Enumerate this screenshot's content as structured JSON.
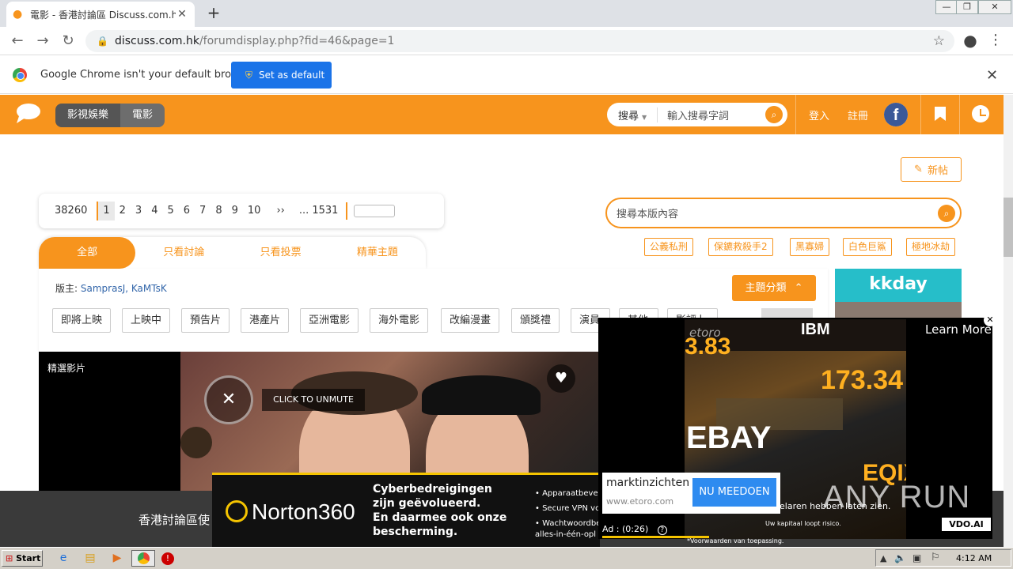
{
  "browser": {
    "tab_title": "電影 - 香港討論區 Discuss.com.hk -",
    "new_tab": "+",
    "url_host": "discuss.com.hk",
    "url_path": "/forumdisplay.php?fid=46&page=1",
    "window_controls": [
      "—",
      "❐",
      "✕"
    ]
  },
  "infobar": {
    "message": "Google Chrome isn't your default browser",
    "button": "Set as default"
  },
  "header": {
    "crumbs": [
      "影視娛樂",
      "電影"
    ],
    "search_type": "搜尋",
    "search_placeholder": "輸入搜尋字詞",
    "login": "登入",
    "register": "註冊",
    "facebook": "f"
  },
  "actions": {
    "new_post": "新帖"
  },
  "pager": {
    "total": "38260",
    "pages": [
      "1",
      "2",
      "3",
      "4",
      "5",
      "6",
      "7",
      "8",
      "9",
      "10"
    ],
    "next": "››",
    "last": "... 1531"
  },
  "board_search": {
    "placeholder": "搜尋本版內容"
  },
  "hot_tags": [
    "公義私刑",
    "保鑣救殺手2",
    "黑寡婦",
    "白色巨鯊",
    "極地冰劫"
  ],
  "filter_tabs": [
    "全部",
    "只看討論",
    "只看投票",
    "精華主題"
  ],
  "moderators": {
    "label": "版主:",
    "names": "SamprasJ, KaMTsK"
  },
  "topic_category": "主題分類",
  "categories": [
    "即將上映",
    "上映中",
    "預告片",
    "港產片",
    "亞洲電影",
    "海外電影",
    "改編漫畫",
    "頒獎禮",
    "演員",
    "其他",
    "影評卜"
  ],
  "featured": {
    "label": "精選影片",
    "unmute": "CLICK TO UNMUTE"
  },
  "kkday": "kkday",
  "footer_band_text": "香港討論區使",
  "norton": {
    "logo": "Norton360",
    "headline": [
      "Cyberbedreigingen",
      "zijn geëvolueerd.",
      "En daarmee ook onze",
      "bescherming."
    ],
    "bullets": [
      "• Apparaatbeveili",
      "• Secure VPN voo",
      "• Wachtwoordbel",
      "  alles-in-één-opl"
    ]
  },
  "etoro": {
    "learn_more": "Learn More",
    "close": "✕",
    "name": "marktinzichten",
    "url": "www.etoro.com",
    "cta": "NU MEEDOEN",
    "timer": "Ad : (0:26)",
    "disclaimer1": "elaren hebben laten zien.",
    "disclaimer2": "Uw kapitaal loopt risico.",
    "disclaimer3": "*Voorwaarden van toepassing.",
    "brand": "etoro",
    "tickers": [
      "IBM",
      "173.34",
      "EBAY",
      "EQIX",
      "3.83"
    ],
    "vdo": "VDO.AI"
  },
  "watermark": "ANY RUN",
  "taskbar": {
    "start": "Start",
    "time": "4:12 AM"
  }
}
